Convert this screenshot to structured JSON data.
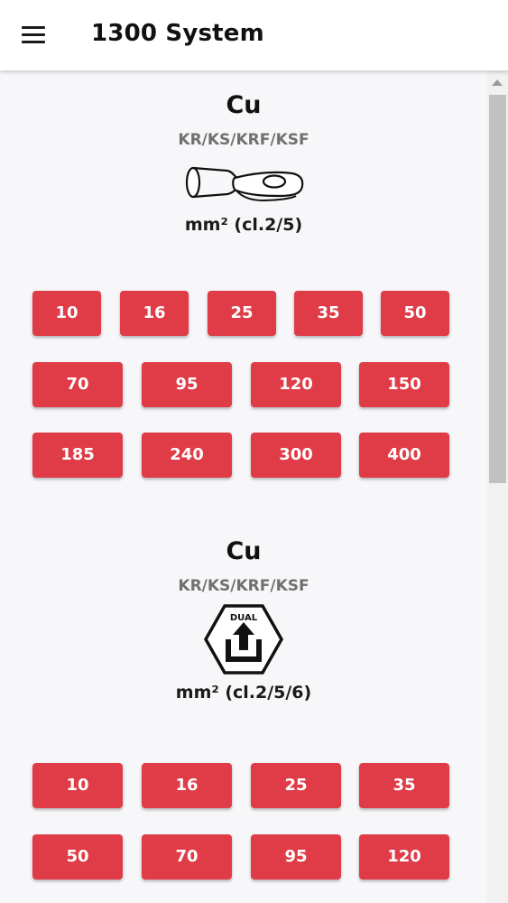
{
  "app_bar": {
    "title": "1300 System",
    "menu_icon": "hamburger-menu-icon"
  },
  "sections": [
    {
      "title": "Cu",
      "subtitle": "KR/KS/KRF/KSF",
      "icon": "cable-lug-icon",
      "unit": "mm² (cl.2/5)",
      "sizes": [
        "10",
        "16",
        "25",
        "35",
        "50",
        "70",
        "95",
        "120",
        "150",
        "185",
        "240",
        "300",
        "400"
      ]
    },
    {
      "title": "Cu",
      "subtitle": "KR/KS/KRF/KSF",
      "icon": "dual-hexagon-icon",
      "icon_text": "DUAL",
      "unit": "mm² (cl.2/5/6)",
      "sizes": [
        "10",
        "16",
        "25",
        "35",
        "50",
        "70",
        "95",
        "120"
      ]
    }
  ],
  "colors": {
    "accent": "#df3c47",
    "background": "#f7f7f9",
    "app_bar": "#ffffff"
  }
}
